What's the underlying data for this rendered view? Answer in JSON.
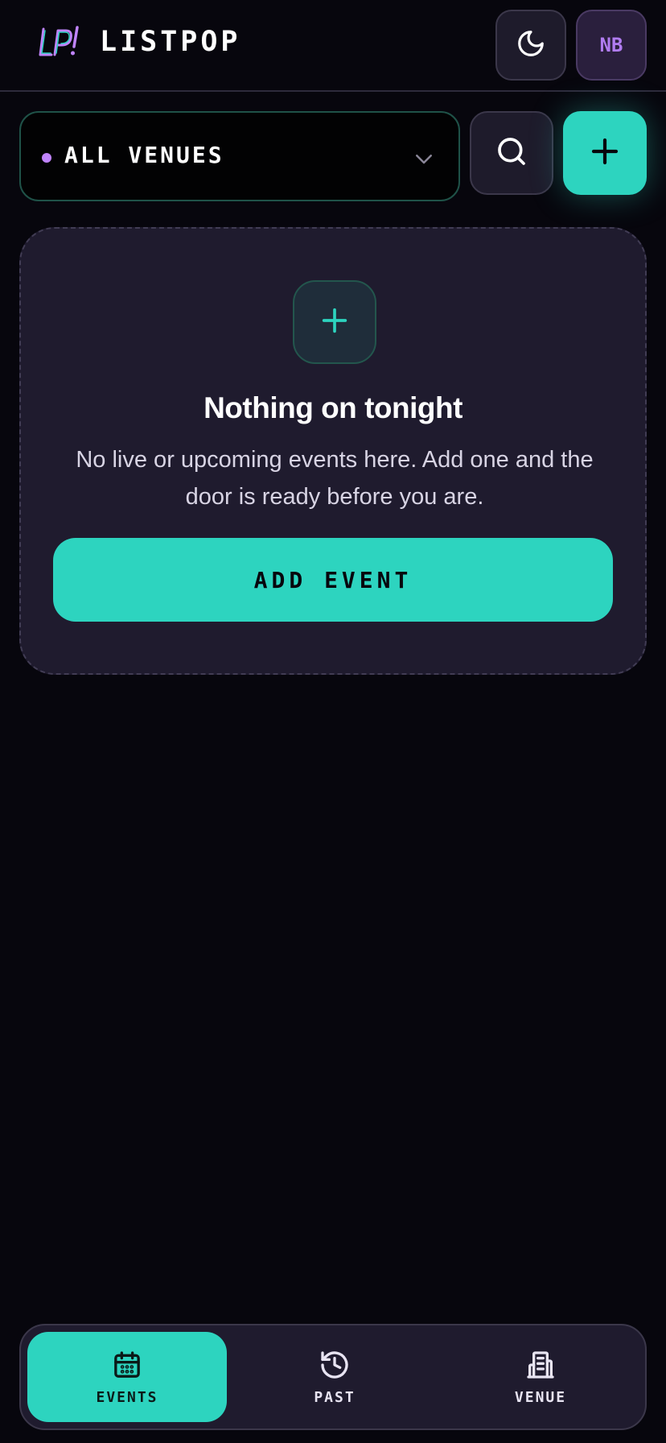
{
  "app": {
    "brand": "LISTPOP",
    "logo_text": "LP!"
  },
  "header": {
    "theme_icon": "moon-icon",
    "avatar_initials": "NB"
  },
  "toolbar": {
    "venue_select_value": "ALL VENUES",
    "search_icon": "search-icon",
    "add_icon": "plus-icon"
  },
  "empty_state": {
    "icon": "plus-icon",
    "title": "Nothing on tonight",
    "message": "No live or upcoming events here. Add one and the door is ready before you are.",
    "button_label": "ADD EVENT"
  },
  "bottom_nav": {
    "items": [
      {
        "label": "EVENTS",
        "icon": "calendar-icon",
        "active": true
      },
      {
        "label": "PAST",
        "icon": "history-icon",
        "active": false
      },
      {
        "label": "VENUE",
        "icon": "building-icon",
        "active": false
      }
    ]
  },
  "colors": {
    "background": "#07060d",
    "accent": "#2dd4bf",
    "card": "#1f1b2e",
    "purple": "#c084fc"
  }
}
